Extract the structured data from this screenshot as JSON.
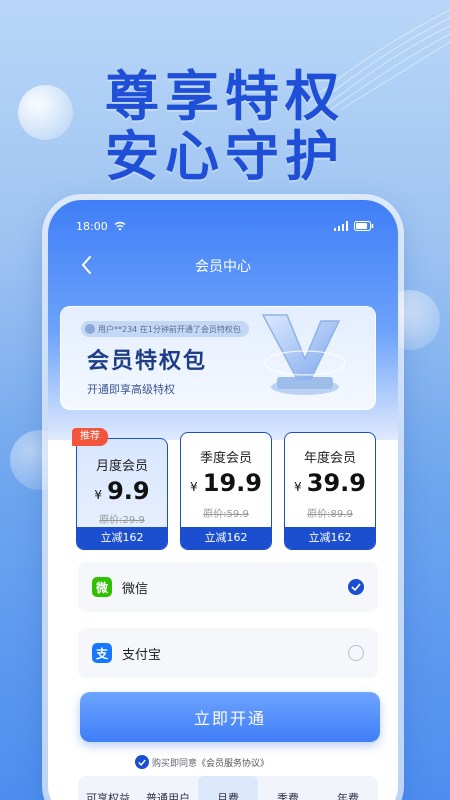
{
  "promo": {
    "headline_line1": "尊享特权",
    "headline_line2": "安心守护"
  },
  "status_bar": {
    "time": "18:00"
  },
  "nav": {
    "title": "会员中心"
  },
  "banner": {
    "notice": "用户**234 在1分钟前开通了会员特权包",
    "title": "会员特权包",
    "subtitle": "开通即享高级特权"
  },
  "plans": [
    {
      "name": "月度会员",
      "currency": "¥",
      "price": "9.9",
      "original": "原价:29.9",
      "saving": "立减162",
      "badge": "推荐",
      "selected": true
    },
    {
      "name": "季度会员",
      "currency": "¥",
      "price": "19.9",
      "original": "原价:59.9",
      "saving": "立减162",
      "selected": false
    },
    {
      "name": "年度会员",
      "currency": "¥",
      "price": "39.9",
      "original": "原价:89.9",
      "saving": "立减162",
      "selected": false
    }
  ],
  "payment": {
    "wechat_label": "微信",
    "alipay_label": "支付宝",
    "wechat_icon_text": "微",
    "alipay_icon_text": "支",
    "selected": "wechat"
  },
  "cta": {
    "label": "立即开通"
  },
  "agreement": {
    "prefix": "购买即同意",
    "link": "《会员服务协议》"
  },
  "compare": {
    "columns": [
      "可享权益",
      "普通用户",
      "月费",
      "季费",
      "年费"
    ]
  },
  "colors": {
    "brand": "#1b4fd0",
    "badge": "#f2553c",
    "wechat": "#2dc100",
    "alipay": "#1677ff"
  }
}
